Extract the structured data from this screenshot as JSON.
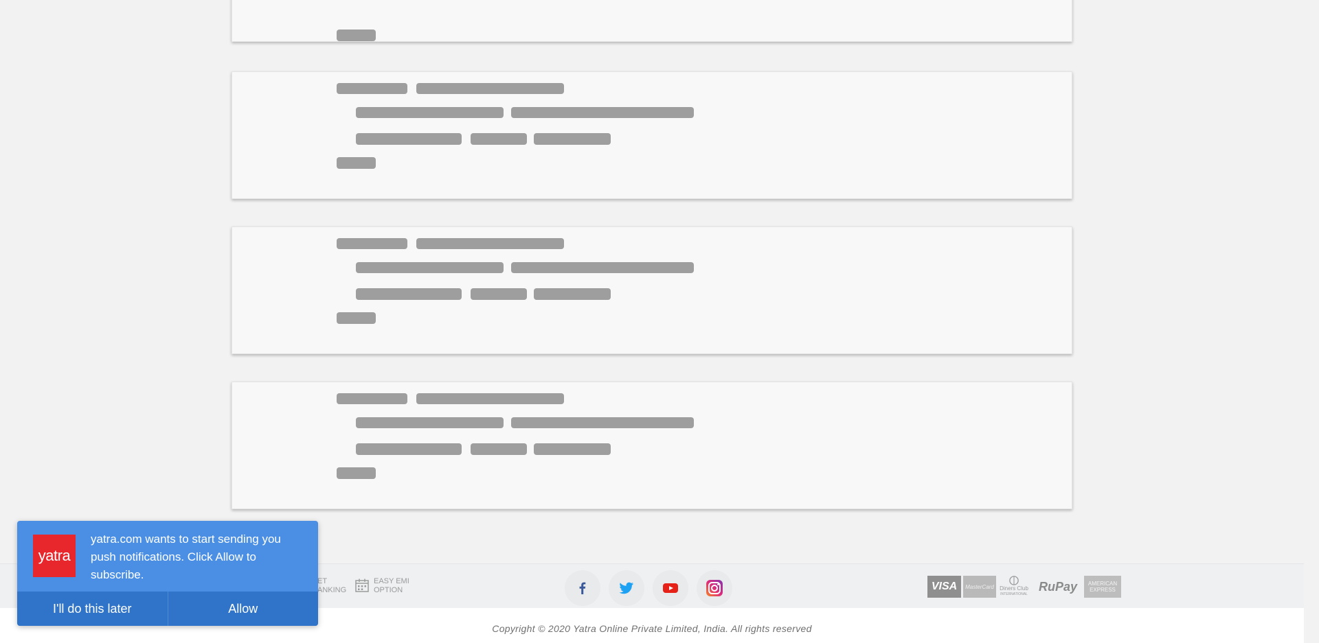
{
  "skeleton_cards": [
    {
      "state": "loading"
    },
    {
      "state": "loading"
    },
    {
      "state": "loading"
    },
    {
      "state": "loading"
    }
  ],
  "footer": {
    "features": [
      {
        "label_line1": "ET",
        "label_line2": "ANKING",
        "icon": "net-banking-icon"
      },
      {
        "label_line1": "EASY EMI",
        "label_line2": "OPTION",
        "icon": "calendar-icon"
      }
    ],
    "social": [
      {
        "name": "facebook",
        "icon": "facebook-icon",
        "color": "#3b5998"
      },
      {
        "name": "twitter",
        "icon": "twitter-icon",
        "color": "#1da1f2"
      },
      {
        "name": "youtube",
        "icon": "youtube-icon",
        "color": "#e62117"
      },
      {
        "name": "instagram",
        "icon": "instagram-icon",
        "color": "#c13584"
      }
    ],
    "payments": {
      "visa": "VISA",
      "mastercard": "MasterCard",
      "diners_line1": "Diners Club",
      "diners_line2": "INTERNATIONAL",
      "rupay": "RuPay",
      "amex_line1": "AMERICAN",
      "amex_line2": "EXPRESS"
    },
    "copyright": "Copyright © 2020 Yatra Online Private Limited, India. All rights reserved"
  },
  "notification_popup": {
    "logo_text": "yatra",
    "message": "yatra.com wants to start sending you push notifications. Click Allow to subscribe.",
    "later_label": "I'll do this later",
    "allow_label": "Allow",
    "bg_color": "#4a8fe3",
    "logo_color": "#e8272d"
  }
}
